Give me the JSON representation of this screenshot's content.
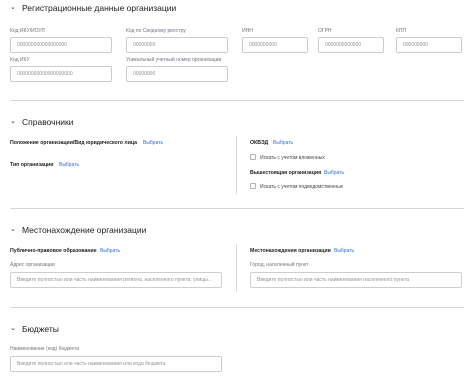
{
  "sections": {
    "registration": {
      "title": "Регистрационные данные организации",
      "fields": [
        {
          "label": "Код ИКУ/ИОУЛ",
          "value": "000000000000000000"
        },
        {
          "label": "Код по Сводному реестру",
          "value": "00000000"
        },
        {
          "label": "ИНН",
          "value": "0000000000"
        },
        {
          "label": "ОГРН",
          "value": "0000000000000"
        },
        {
          "label": "КПП",
          "value": "000000000"
        },
        {
          "label": "Код ИКУ",
          "value": "00000000000000000000"
        },
        {
          "label": "Уникальный учетный номер организации",
          "value": "00000000"
        }
      ]
    },
    "references": {
      "title": "Справочники",
      "legal_form_label": "Положение организации/Вид юридического лица",
      "org_type_label": "Тип организации",
      "okved_label": "ОКВЭД",
      "okved_checkbox": "Искать с учетом вложенных",
      "parent_org_label": "Вышестоящая организация",
      "parent_checkbox": "Искать с учетом подведомственных",
      "select_link": "Выбрать"
    },
    "location": {
      "title": "Местонахождение организации",
      "public_entity_label": "Публично-правовое образование",
      "org_location_label": "Местонахождения организации",
      "address_label": "Адрес организации",
      "address_placeholder": "Введите полностью или часть наименования региона, населенного пункта, улицы...",
      "city_label": "Город, населенный пункт",
      "city_placeholder": "Введите полностью или часть наименования населенного пункта",
      "select_link": "Выбрать"
    },
    "budgets": {
      "title": "Бюджеты",
      "budget_label": "Наименование (код) бюджета",
      "budget_placeholder": "Введите полностью или часть наименования или кода бюджета"
    }
  }
}
